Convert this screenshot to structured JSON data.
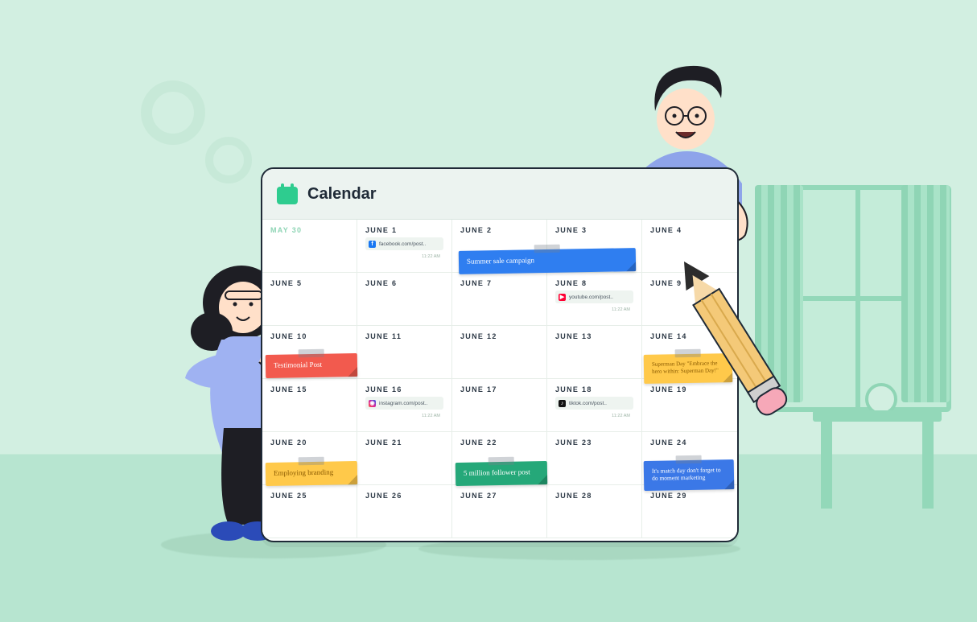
{
  "title": "Calendar",
  "muted_day": "May 30",
  "days": [
    "May 30",
    "June 1",
    "June 2",
    "June 3",
    "June 4",
    "June 5",
    "June 6",
    "June 7",
    "June 8",
    "June 9",
    "June 10",
    "June 11",
    "June 12",
    "June 13",
    "June 14",
    "June 15",
    "June 16",
    "June 17",
    "June 18",
    "June 19",
    "June 20",
    "June 21",
    "June 22",
    "June 23",
    "June 24",
    "June 25",
    "June 26",
    "June 27",
    "June 28",
    "June 29"
  ],
  "chips": {
    "june1": {
      "icon": "fb",
      "text": "facebook.com/post..",
      "time": "11:22 AM"
    },
    "june8": {
      "icon": "yt",
      "text": "youtube.com/post..",
      "time": "11:22 AM"
    },
    "june16": {
      "icon": "ig",
      "text": "instagram.com/post..",
      "time": "11:22 AM"
    },
    "june18": {
      "icon": "tk",
      "text": "tiktok.com/post..",
      "time": "11:22 AM"
    }
  },
  "stickies": {
    "summer": "Summer sale campaign",
    "testimonial": "Testimonial Post",
    "superman": "Superman Day \"Embrace the hero within: Superman Day!\"",
    "employing": "Employing branding",
    "million": "5 million follower post",
    "match": "It's match day don't forget to do moment marketing"
  }
}
